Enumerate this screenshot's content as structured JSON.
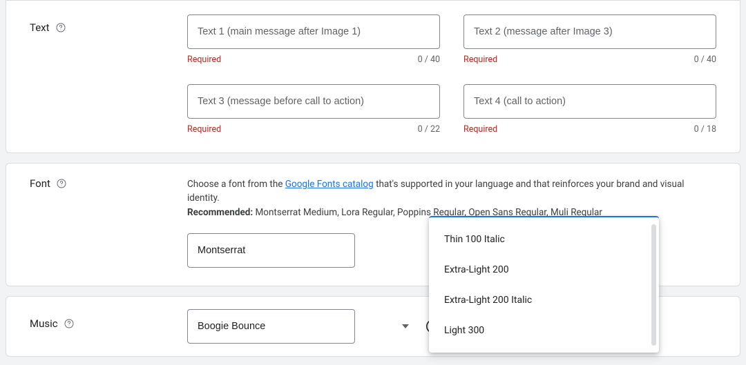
{
  "text_section": {
    "label": "Text",
    "fields": [
      {
        "placeholder": "Text 1 (main message after Image 1)",
        "value": "",
        "required_label": "Required",
        "counter": "0 / 40"
      },
      {
        "placeholder": "Text 2 (message after Image 3)",
        "value": "",
        "required_label": "Required",
        "counter": "0 / 40"
      },
      {
        "placeholder": "Text 3 (message before call to action)",
        "value": "",
        "required_label": "Required",
        "counter": "0 / 22"
      },
      {
        "placeholder": "Text 4 (call to action)",
        "value": "",
        "required_label": "Required",
        "counter": "0 / 18"
      }
    ]
  },
  "font_section": {
    "label": "Font",
    "desc_prefix": "Choose a font from the ",
    "desc_link": "Google Fonts catalog",
    "desc_suffix": " that's supported in your language and that reinforces your brand and visual identity.",
    "recommended_label": "Recommended:",
    "recommended_list": " Montserrat Medium, Lora Regular, Poppins Regular, Open Sans Regular, Muli Regular",
    "font_family_value": "Montserrat",
    "weight_options": [
      "Thin 100 Italic",
      "Extra-Light 200",
      "Extra-Light 200 Italic",
      "Light 300"
    ]
  },
  "music_section": {
    "label": "Music",
    "track_value": "Boogie Bounce"
  }
}
